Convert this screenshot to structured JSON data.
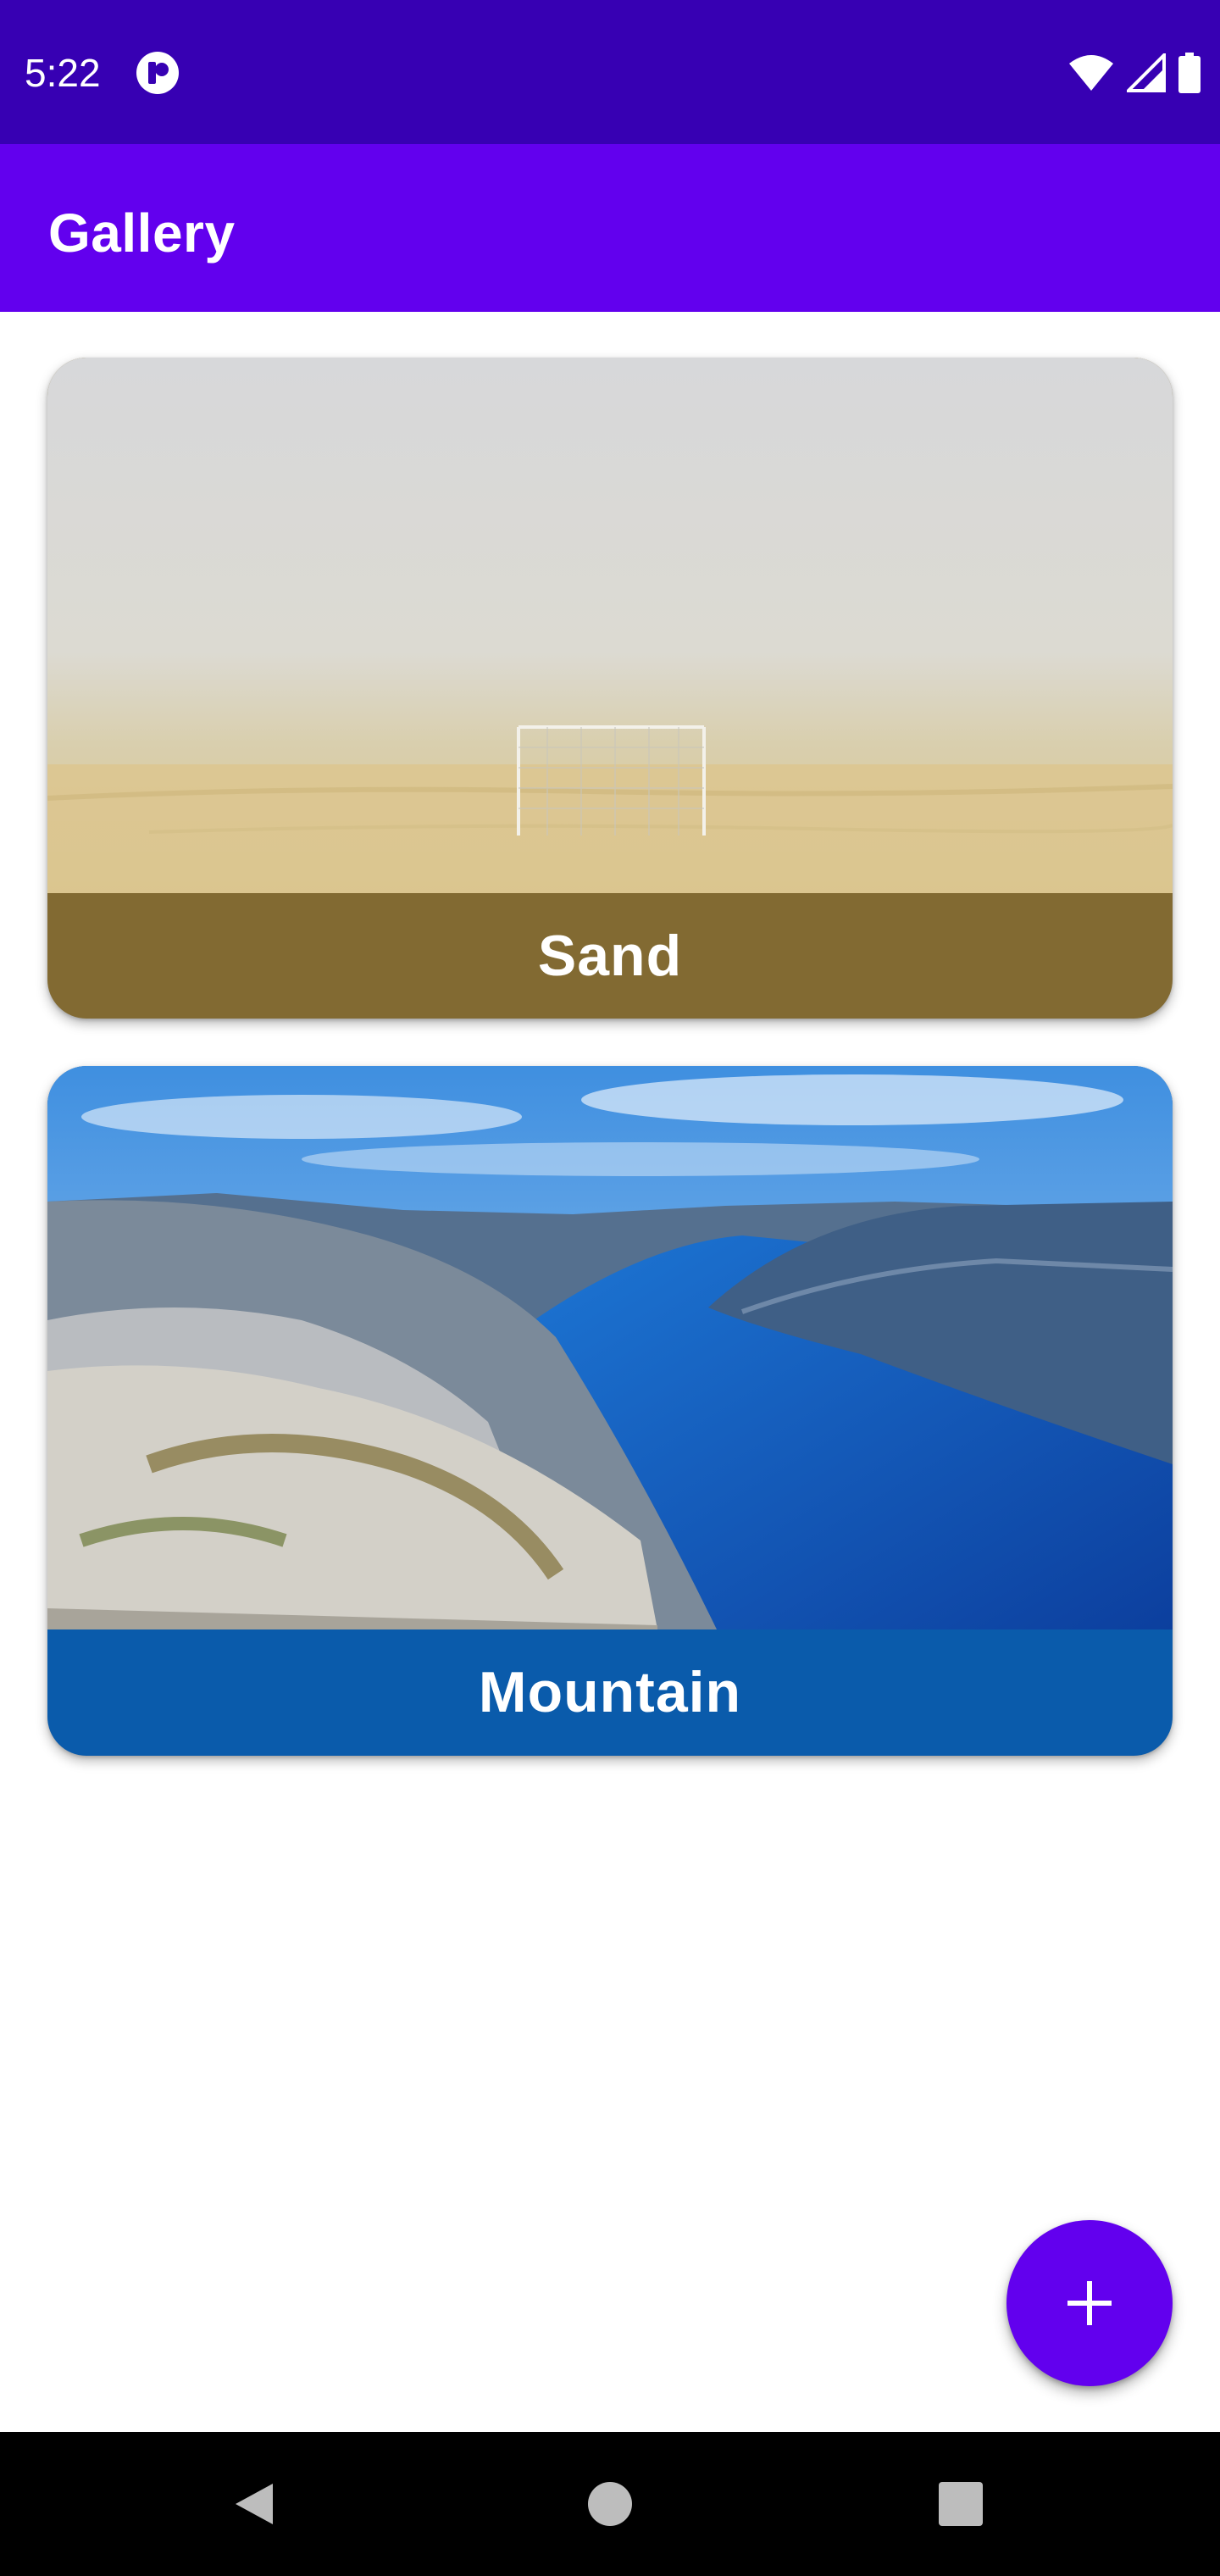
{
  "status_bar": {
    "time": "5:22",
    "icons": [
      "app-notification-icon",
      "wifi-icon",
      "signal-icon",
      "battery-icon"
    ]
  },
  "app_bar": {
    "title": "Gallery"
  },
  "cards": [
    {
      "caption": "Sand",
      "caption_bg": "#826a32",
      "image": "sand-field-goal-photo"
    },
    {
      "caption": "Mountain",
      "caption_bg": "#0a5bab",
      "image": "fjord-mountain-photo"
    }
  ],
  "fab": {
    "icon": "plus-icon",
    "color": "#6200ee"
  },
  "nav_bar": {
    "icons": [
      "back-icon",
      "home-icon",
      "recents-icon"
    ]
  },
  "colors": {
    "status_bar": "#3700b3",
    "app_bar": "#6200ee",
    "background": "#ffffff"
  }
}
